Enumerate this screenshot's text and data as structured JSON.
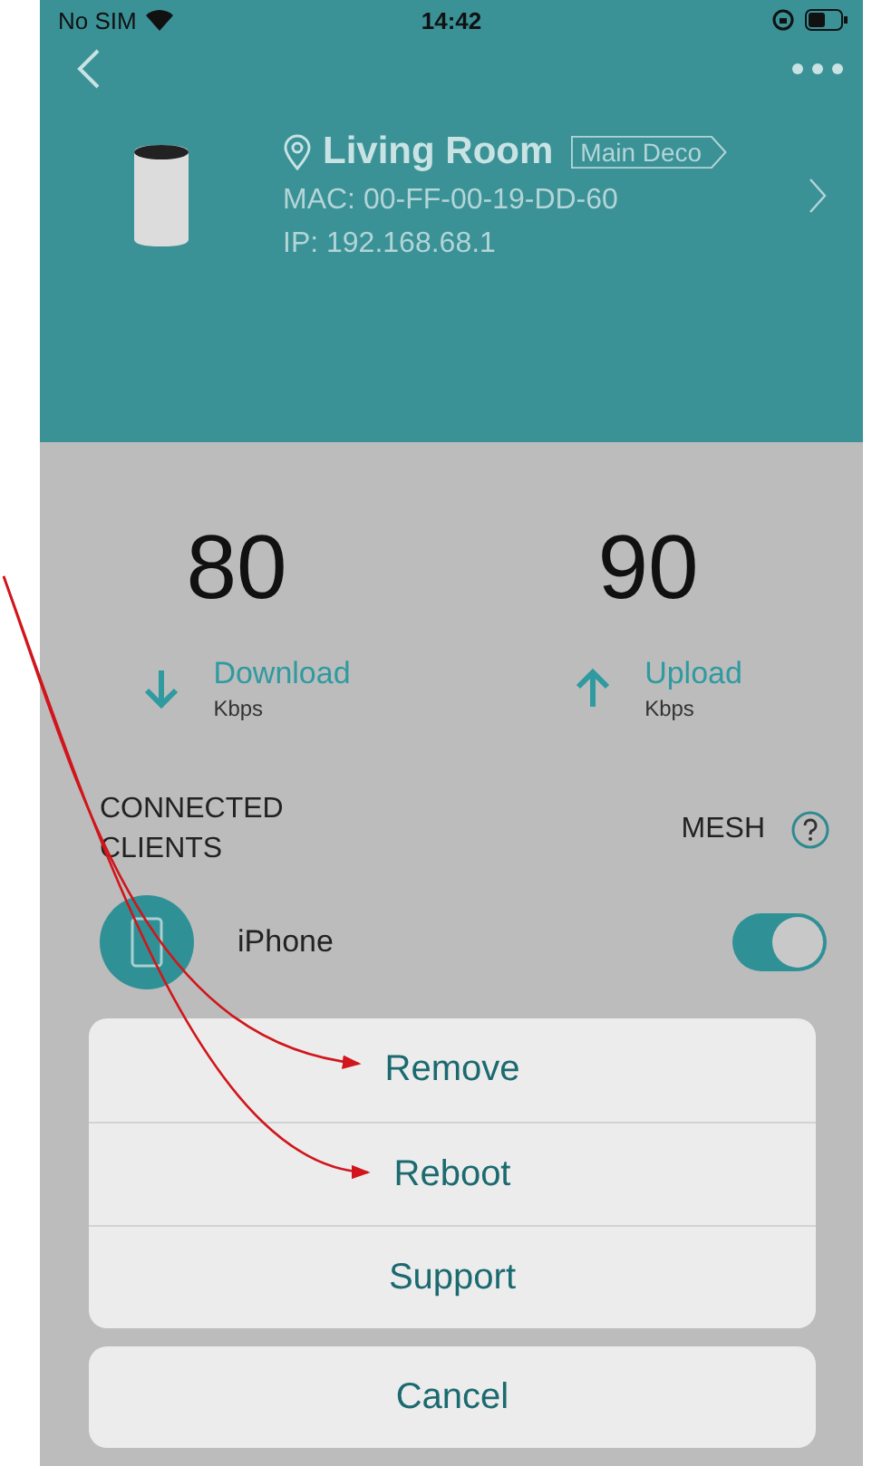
{
  "status_bar": {
    "carrier": "No SIM",
    "time": "14:42"
  },
  "header": {
    "location": "Living Room",
    "badge": "Main Deco",
    "mac": "MAC: 00-FF-00-19-DD-60",
    "ip": "IP: 192.168.68.1"
  },
  "speeds": [
    {
      "kind": "download",
      "value": "80",
      "label": "Download",
      "unit": "Kbps"
    },
    {
      "kind": "upload",
      "value": "90",
      "label": "Upload",
      "unit": "Kbps"
    }
  ],
  "section": {
    "title": "CONNECTED CLIENTS",
    "mesh_label": "MESH"
  },
  "clients": [
    {
      "name": "iPhone",
      "on": true
    }
  ],
  "action_sheet": {
    "actions": [
      "Remove",
      "Reboot",
      "Support"
    ],
    "cancel": "Cancel"
  }
}
